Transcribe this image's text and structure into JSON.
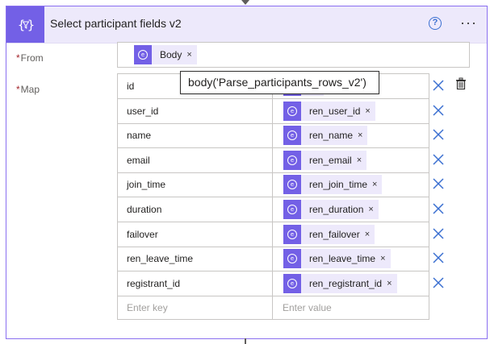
{
  "header": {
    "title": "Select participant fields v2",
    "help_label": "?",
    "more_label": "···"
  },
  "from": {
    "label": "From",
    "required_mark": "*",
    "token": {
      "label": "Body",
      "remove": "×"
    }
  },
  "map": {
    "label": "Map",
    "required_mark": "*",
    "rows": [
      {
        "key": "id",
        "value": ""
      },
      {
        "key": "user_id",
        "value": "ren_user_id"
      },
      {
        "key": "name",
        "value": "ren_name"
      },
      {
        "key": "email",
        "value": "ren_email"
      },
      {
        "key": "join_time",
        "value": "ren_join_time"
      },
      {
        "key": "duration",
        "value": "ren_duration"
      },
      {
        "key": "failover",
        "value": "ren_failover"
      },
      {
        "key": "ren_leave_time",
        "value": "ren_leave_time"
      },
      {
        "key": "registrant_id",
        "value": "ren_registrant_id"
      }
    ],
    "key_placeholder": "Enter key",
    "value_placeholder": "Enter value",
    "token_remove": "×"
  },
  "tooltip": {
    "text": "body('Parse_participants_rows_v2')"
  },
  "colors": {
    "accent": "#7360e6",
    "header_bg": "#ede9fb",
    "link_blue": "#3a6fd1"
  },
  "icons": {
    "action": "select-action-icon",
    "help": "help-icon",
    "more": "more-icon",
    "token": "expression-token-icon",
    "delete": "close-icon",
    "trash": "trash-icon"
  }
}
